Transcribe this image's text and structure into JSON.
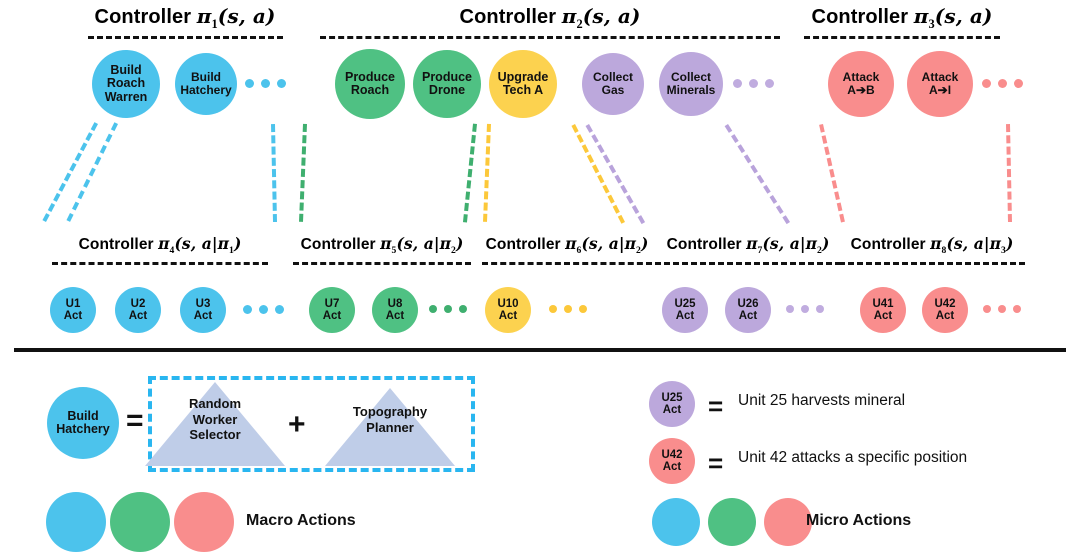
{
  "diagram": {
    "title": "Hierarchical controller / macro-micro action decomposition",
    "colors": {
      "blue": "#4CC3EC",
      "green": "#4FC183",
      "yellow": "#FCD24F",
      "purple": "#BCA8DC",
      "red": "#F98D8D",
      "triangle": "#BFCDE8",
      "dashbox": "#29B6F0",
      "divider": "#111111"
    }
  },
  "macro_controllers": [
    {
      "id": "pi1",
      "label_prefix": "Controller",
      "pi": "π",
      "subscript": "1",
      "args": "(s, a)",
      "nodes": [
        {
          "label": "Build\nRoach\nWarren",
          "color": "blue"
        },
        {
          "label": "Build\nHatchery",
          "color": "blue"
        }
      ],
      "ellipsis_color": "blue"
    },
    {
      "id": "pi2",
      "label_prefix": "Controller",
      "pi": "π",
      "subscript": "2",
      "args": "(s, a)",
      "nodes": [
        {
          "label": "Produce\nRoach",
          "color": "green"
        },
        {
          "label": "Produce\nDrone",
          "color": "green"
        },
        {
          "label": "Upgrade\nTech A",
          "color": "yellow"
        },
        {
          "label": "Collect\nGas",
          "color": "purple"
        },
        {
          "label": "Collect\nMinerals",
          "color": "purple"
        }
      ],
      "ellipsis_color": "purple"
    },
    {
      "id": "pi3",
      "label_prefix": "Controller",
      "pi": "π",
      "subscript": "3",
      "args": "(s, a)",
      "nodes": [
        {
          "label": "Attack\nA➔B",
          "color": "red"
        },
        {
          "label": "Attack\nA➔I",
          "color": "red"
        }
      ],
      "ellipsis_color": "red"
    }
  ],
  "micro_controllers": [
    {
      "id": "pi4",
      "label_prefix": "Controller",
      "pi": "π",
      "subscript": "4",
      "args": "(s, a|π",
      "args_sub": "1",
      "args_end": ")",
      "nodes": [
        {
          "unit": "U1",
          "act": "Act",
          "color": "blue"
        },
        {
          "unit": "U2",
          "act": "Act",
          "color": "blue"
        },
        {
          "unit": "U3",
          "act": "Act",
          "color": "blue"
        }
      ],
      "ellipsis_color": "blue"
    },
    {
      "id": "pi5",
      "label_prefix": "Controller",
      "pi": "π",
      "subscript": "5",
      "args": "(s, a|π",
      "args_sub": "2",
      "args_end": ")",
      "nodes": [
        {
          "unit": "U7",
          "act": "Act",
          "color": "green"
        },
        {
          "unit": "U8",
          "act": "Act",
          "color": "green"
        }
      ],
      "ellipsis_color": "green"
    },
    {
      "id": "pi6",
      "label_prefix": "Controller",
      "pi": "π",
      "subscript": "6",
      "args": "(s, a|π",
      "args_sub": "2",
      "args_end": ")",
      "nodes": [
        {
          "unit": "U10",
          "act": "Act",
          "color": "yellow"
        }
      ],
      "ellipsis_color": "yellow"
    },
    {
      "id": "pi7",
      "label_prefix": "Controller",
      "pi": "π",
      "subscript": "7",
      "args": "(s, a|π",
      "args_sub": "2",
      "args_end": ")",
      "nodes": [
        {
          "unit": "U25",
          "act": "Act",
          "color": "purple"
        },
        {
          "unit": "U26",
          "act": "Act",
          "color": "purple"
        }
      ],
      "ellipsis_color": "purple"
    },
    {
      "id": "pi8",
      "label_prefix": "Controller",
      "pi": "π",
      "subscript": "8",
      "args": "(s, a|π",
      "args_sub": "3",
      "args_end": ")",
      "nodes": [
        {
          "unit": "U41",
          "act": "Act",
          "color": "red"
        },
        {
          "unit": "U42",
          "act": "Act",
          "color": "red"
        }
      ],
      "ellipsis_color": "red"
    }
  ],
  "legend": {
    "decomposition": {
      "circle_label": "Build\nHatchery",
      "circle_color": "blue",
      "equals": "=",
      "plus": "+",
      "components": [
        {
          "label": "Random\nWorker\nSelector"
        },
        {
          "label": "Topography\nPlanner"
        }
      ]
    },
    "examples": [
      {
        "unit": "U25",
        "act": "Act",
        "color": "purple",
        "equals": "=",
        "text": "Unit 25 harvests mineral"
      },
      {
        "unit": "U42",
        "act": "Act",
        "color": "red",
        "equals": "=",
        "text": "Unit 42 attacks a specific position"
      }
    ],
    "macro_key": {
      "label": "Macro Actions",
      "swatches": [
        "blue",
        "green",
        "red"
      ]
    },
    "micro_key": {
      "label": "Micro Actions",
      "swatches": [
        "blue",
        "green",
        "red"
      ]
    }
  }
}
